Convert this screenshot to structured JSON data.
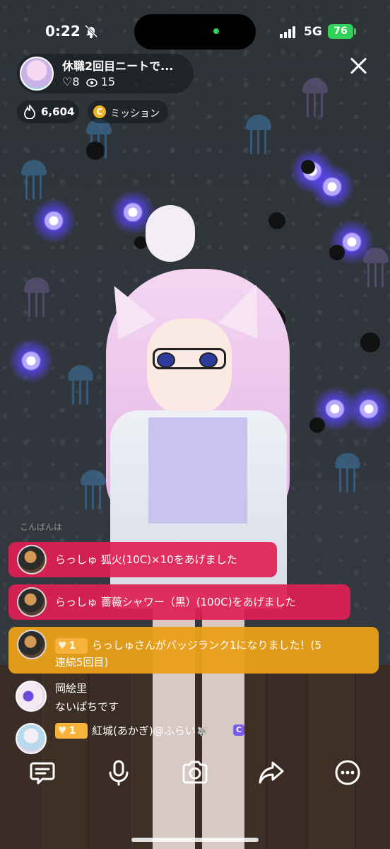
{
  "status_bar": {
    "time": "0:22",
    "network": "5G",
    "battery": "76",
    "icons": [
      "bell-slash-icon",
      "signal-icon",
      "battery-icon"
    ],
    "colors": {
      "island_dot": "#30d158",
      "battery": "#30d158"
    }
  },
  "stream": {
    "title": "休職2回目ニートで...",
    "likes": "♡8",
    "viewers": "15",
    "points": "6,604",
    "mission_label": "ミッション",
    "mission_coin": "C"
  },
  "chat": {
    "partial_line": "こんばんは",
    "messages": [
      {
        "type": "gift",
        "user": "らっしゅ",
        "text": "らっしゅ 狐火(10C)×10をあげました",
        "color": "#de1e52"
      },
      {
        "type": "gift",
        "user": "らっしゅ",
        "text": "らっしゅ 薔薇シャワー（黒）(100C)をあげました",
        "color": "#de1e52"
      },
      {
        "type": "rank",
        "badge": "1",
        "text": "らっしゅさんがバッジランク1になりました！(5",
        "text2": "連続5回目)",
        "color": "#eaa019"
      },
      {
        "type": "comment",
        "name": "岡絵里",
        "text": "ないぱちです"
      },
      {
        "type": "comment",
        "badge": "1",
        "name": "紅城(あかぎ)@ふらい",
        "emoji": "🐺",
        "c_icon": "C"
      }
    ]
  },
  "toolbar": {
    "items": [
      "comment-icon",
      "microphone-icon",
      "camera-icon",
      "share-icon",
      "more-icon"
    ]
  }
}
